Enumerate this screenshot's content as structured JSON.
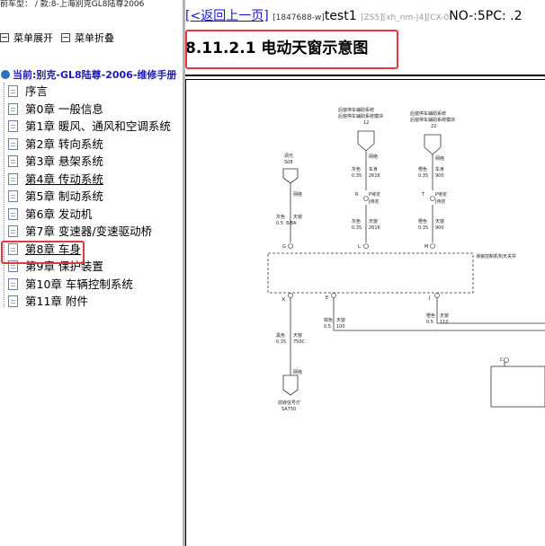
{
  "window": {
    "top_text": "前车型：  /  款:8-上海别克GL8陆尊2006"
  },
  "toolbar": {
    "expand_label": "菜单展开",
    "collapse_label": "菜单折叠"
  },
  "tree": {
    "root_label": "当前:别克-GL8陆尊-2006-维修手册",
    "items": [
      {
        "label": "序言"
      },
      {
        "label": "第0章 一般信息"
      },
      {
        "label": "第1章 暖风、通风和空调系统"
      },
      {
        "label": "第2章 转向系统"
      },
      {
        "label": "第3章 悬架系统"
      },
      {
        "label": "第4章 传动系统"
      },
      {
        "label": "第5章 制动系统"
      },
      {
        "label": "第6章 发动机"
      },
      {
        "label": "第7章 变速器/变速驱动桥"
      },
      {
        "label": "第8章 车身"
      },
      {
        "label": "第9章 保护装置"
      },
      {
        "label": "第10章 车辆控制系统"
      },
      {
        "label": "第11章 附件"
      }
    ]
  },
  "content": {
    "back_link": "[<返回上一页]",
    "doc_id": "[1847688-w]",
    "test_label": "test1",
    "meta_grey": "[ZS5][xh_nm-|4][CX-0",
    "meta_dark": "NO-:5PC: .2",
    "title": "8.11.2.1 电动天窗示意图"
  },
  "diagram": {
    "mod_left_1": "后窗停车辅助系统",
    "mod_left_2": "后窗停车辅助系统模块",
    "mod_left_num": "12",
    "mod_right_1": "后窗停车辅助系统",
    "mod_right_2": "后窗停车辅助系统模块",
    "mod_right_num": "22",
    "dim_label_1": "调光",
    "dim_label_2": "S08",
    "net_label": "网络",
    "c1_color": "灰色",
    "c1_gauge": "0.5",
    "c1_circuit": "8/8A",
    "c1_pin": "天窗",
    "c2_top_color": "灰色",
    "c2_top_gauge": "0.35",
    "c2_top_circuit": "2616",
    "c2_top_pin": "车身",
    "c2_mid_r": "R",
    "c2_mid_text1": "P待定",
    "c2_mid_text2": "J待定",
    "c2_bot_color": "灰色",
    "c2_bot_gauge": "0.35",
    "c2_bot_circuit": "2616",
    "c2_bot_pin": "天窗",
    "c3_top_color": "橙色",
    "c3_top_gauge": "0.35",
    "c3_top_circuit": "900",
    "c3_top_pin": "车身",
    "c3_mid_t": "T",
    "c3_mid_text1": "P待定",
    "c3_mid_text2": "J待定",
    "c3_bot_color": "橙色",
    "c3_bot_gauge": "0.35",
    "c3_bot_circuit": "900",
    "c3_bot_pin": "天窗",
    "pin_g": "G",
    "pin_l": "L",
    "pin_m": "M",
    "pin_k": "K",
    "pin_e": "E",
    "pin_j": "J",
    "pin_c": "C",
    "module_label": "滑装控制机构天关井",
    "b1_color": "黑色",
    "b1_gauge": "0.35",
    "b1_circuit": "750C",
    "b1_pin": "天窗",
    "b2_color": "棕色",
    "b2_gauge": "0.5",
    "b2_circuit": "100",
    "b2_pin": "天窗",
    "b3_color": "橙色",
    "b3_gauge": "0.5",
    "b3_circuit": "110",
    "b3_pin": "天窗",
    "ground_label_1": "前转信号灯",
    "ground_label_2": "SA750"
  }
}
